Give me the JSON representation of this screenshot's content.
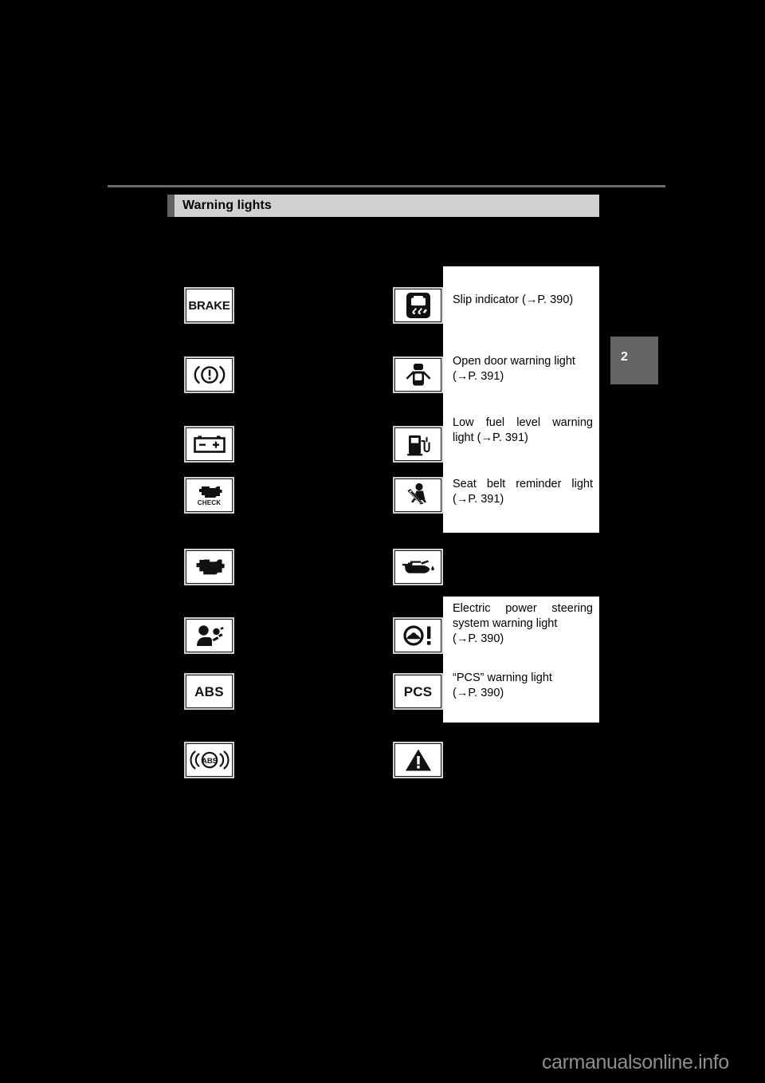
{
  "page": {
    "chapter_tab": "2",
    "watermark": "carmanualsonline.info"
  },
  "header": {
    "title": "Warning lights"
  },
  "columns": {
    "left": [
      {
        "icon": "brake-text-warning-icon",
        "label": "BRAKE",
        "text": ""
      },
      {
        "icon": "brake-system-warning-icon",
        "label": "",
        "text": ""
      },
      {
        "icon": "charging-system-warning-icon",
        "label": "",
        "text": ""
      },
      {
        "icon": "check-engine-warning-icon",
        "label": "CHECK",
        "text": ""
      },
      {
        "icon": "malfunction-indicator-lamp-icon",
        "label": "",
        "text": ""
      },
      {
        "icon": "srs-airbag-warning-icon",
        "label": "",
        "text": ""
      },
      {
        "icon": "abs-warning-icon",
        "label": "ABS",
        "text": ""
      },
      {
        "icon": "brake-assist-warning-icon",
        "label": "ABS",
        "text": ""
      }
    ],
    "right": [
      {
        "icon": "slip-indicator-icon",
        "label": "",
        "line1": "Slip indicator (→P. 390)",
        "line2": ""
      },
      {
        "icon": "open-door-warning-icon",
        "label": "",
        "line1": "Open door warning light",
        "line2": "(→P. 391)"
      },
      {
        "icon": "low-fuel-level-warning-icon",
        "label": "",
        "line1": "Low fuel level warning",
        "line2": "light (→P. 391)"
      },
      {
        "icon": "seat-belt-reminder-icon",
        "label": "",
        "line1": "Seat belt reminder light",
        "line2": "(→P. 391)"
      },
      {
        "icon": "low-oil-pressure-warning-icon",
        "label": "",
        "line1": "",
        "line2": ""
      },
      {
        "icon": "electric-power-steering-warning-icon",
        "label": "",
        "line1": "Electric power steering",
        "line2": "system warning light",
        "line3": "(→P. 390)"
      },
      {
        "icon": "pcs-warning-icon",
        "label": "PCS",
        "line1": "“PCS” warning light",
        "line2": "(→P. 390)"
      },
      {
        "icon": "master-warning-icon",
        "label": "",
        "line1": "",
        "line2": ""
      }
    ]
  },
  "callout_top": {
    "slip": {
      "l1": "Slip indicator (→P. 390)"
    },
    "door": {
      "l1": "Open door warning light",
      "l2": "(→P. 391)"
    },
    "fuel": {
      "l1": "Low fuel level warning",
      "l2": "light (→P. 391)"
    },
    "seatbelt": {
      "l1": "Seat belt reminder light",
      "l2": "(→P. 391)"
    }
  },
  "callout_bottom": {
    "eps": {
      "l1": "Electric power steering",
      "l2": "system warning light",
      "l3": "(→P. 390)"
    },
    "pcs": {
      "l1": "“PCS” warning light",
      "l2": "(→P. 390)"
    }
  }
}
